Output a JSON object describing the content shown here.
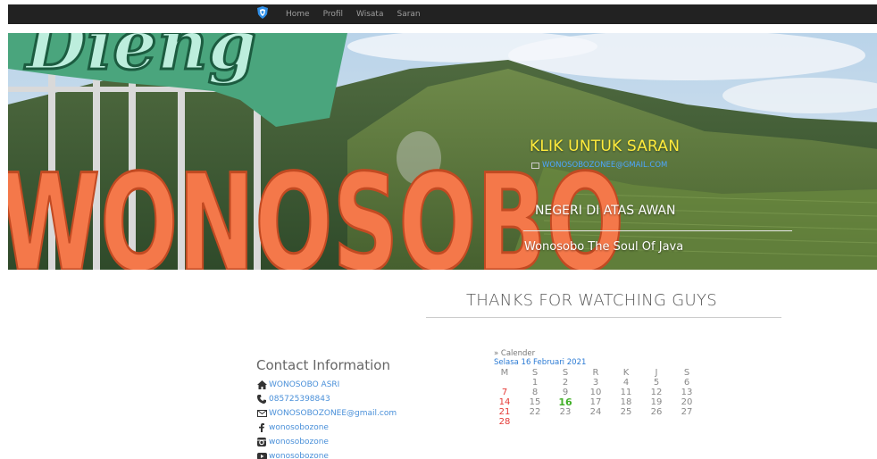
{
  "nav": {
    "brand_icon": "shield-icon",
    "links": [
      "Home",
      "Profil",
      "Wisata",
      "Saran"
    ]
  },
  "hero": {
    "title": "KLIK UNTUK SARAN",
    "email": "WONOSOBOZONEE@GMAIL.COM",
    "subtitle": "NEGERI DI ATAS AWAN",
    "tagline": "Wonosobo The Soul Of Java",
    "sign_word": "WONOSOBO",
    "sign_top_word": "Dieng",
    "colors": {
      "title": "#ffeb3b",
      "email": "#4da6ff",
      "sign": "#f4784a"
    }
  },
  "thanks": "THANKS FOR WATCHING GUYS",
  "contact": {
    "title": "Contact Information",
    "items": [
      {
        "icon": "home-icon",
        "text": "WONOSOBO ASRI"
      },
      {
        "icon": "phone-icon",
        "text": "085725398843"
      },
      {
        "icon": "mail-icon",
        "text": "WONOSOBOZONEE@gmail.com"
      },
      {
        "icon": "facebook-icon",
        "text": "wonosobozone"
      },
      {
        "icon": "instagram-icon",
        "text": "wonosobozone"
      },
      {
        "icon": "youtube-icon",
        "text": "wonosobozone"
      }
    ]
  },
  "calendar": {
    "heading": "» Calender",
    "date": "Selasa 16 Februari 2021",
    "days": [
      "M",
      "S",
      "S",
      "R",
      "K",
      "J",
      "S"
    ],
    "rows": [
      [
        "",
        "1",
        "2",
        "3",
        "4",
        "5",
        "6"
      ],
      [
        "7",
        "8",
        "9",
        "10",
        "11",
        "12",
        "13"
      ],
      [
        "14",
        "15",
        "16",
        "17",
        "18",
        "19",
        "20"
      ],
      [
        "21",
        "22",
        "23",
        "24",
        "25",
        "26",
        "27"
      ],
      [
        "28",
        "",
        "",
        "",
        "",
        "",
        ""
      ]
    ],
    "today": "16",
    "colors": {
      "sunday": "#e53935",
      "today": "#43b02a",
      "date": "#2a7ad4"
    }
  }
}
